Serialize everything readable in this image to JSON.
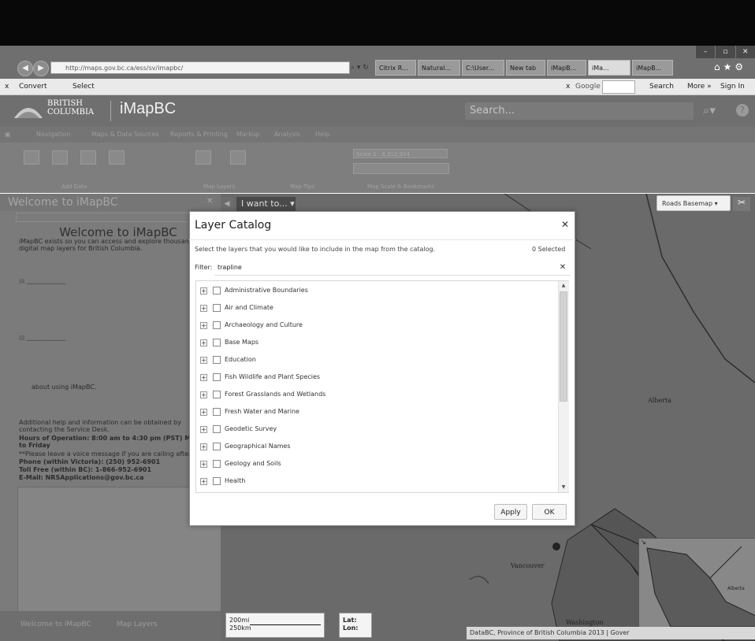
{
  "browser": {
    "url": "http://maps.gov.bc.ca/ess/sv/imapbc/",
    "tabs": [
      "Citrix R...",
      "Natural...",
      "C:\\User...",
      "New tab",
      "iMapB...",
      "iMa...",
      "iMapB..."
    ],
    "toolbar": {
      "convert": "Convert",
      "select": "Select",
      "google": "Google",
      "search": "Search",
      "more": "More »",
      "sign_in": "Sign In"
    }
  },
  "app": {
    "logo": {
      "line1": "BRITISH",
      "line2": "COLUMBIA"
    },
    "title": "iMapBC",
    "search_placeholder": "Search...",
    "ribbon_menu": [
      "Navigation",
      "Maps & Data Sources",
      "Reports & Printing",
      "Markup",
      "Analysis",
      "Help"
    ],
    "ribbon_groups": {
      "add_data": "Add Data",
      "map_layers": "Map Layers",
      "map_tips": "Map Tips",
      "scale": "Map Scale & Bookmarks"
    },
    "scale_value": "Scale 1 : 8,312,924"
  },
  "left_panel": {
    "header": "Welcome to iMapBC",
    "title": "Welcome to iMapBC",
    "intro": "iMapBC exists so you can access and explore thousands of digital map layers for British Columbia.",
    "about": "about using iMapBC.",
    "help": "Additional help and information can be obtained by contacting the Service Desk.",
    "hours": "Hours of Operation: 8:00 am to 4:30 pm (PST) Monday to Friday",
    "voicemail": "**Please leave a voice message if you are calling after hours.",
    "phone_victoria": "Phone (within Victoria): (250) 952-6901",
    "toll_free": "Toll Free (within BC): 1-866-952-6901",
    "email": "E-Mail: NRSApplications@gov.bc.ca",
    "bottom_tabs": [
      "Welcome to iMapBC",
      "Map Layers"
    ]
  },
  "map": {
    "i_want_to": "I want to... ▾",
    "basemap": "Roads Basemap ▾",
    "scale": {
      "line1": "200mi",
      "line2": "250km"
    },
    "latlon": {
      "lat": "Lat:",
      "lon": "Lon:"
    },
    "attribution": "DataBC, Province of British Columbia 2013 | Gover",
    "labels": {
      "alberta": "Alberta",
      "vancouver": "Vancouver",
      "washington": "Washington"
    }
  },
  "dialog": {
    "title": "Layer Catalog",
    "description": "Select the layers that you would like to include in the map from the catalog.",
    "selected_count": "0 Selected",
    "filter_label": "Filter:",
    "filter_value": "trapline",
    "layers": [
      "Administrative Boundaries",
      "Air and Climate",
      "Archaeology and Culture",
      "Base Maps",
      "Education",
      "Fish Wildlife and Plant Species",
      "Forest Grasslands and Wetlands",
      "Fresh Water and Marine",
      "Geodetic Survey",
      "Geographical Names",
      "Geology and Soils",
      "Health"
    ],
    "apply": "Apply",
    "ok": "OK"
  }
}
